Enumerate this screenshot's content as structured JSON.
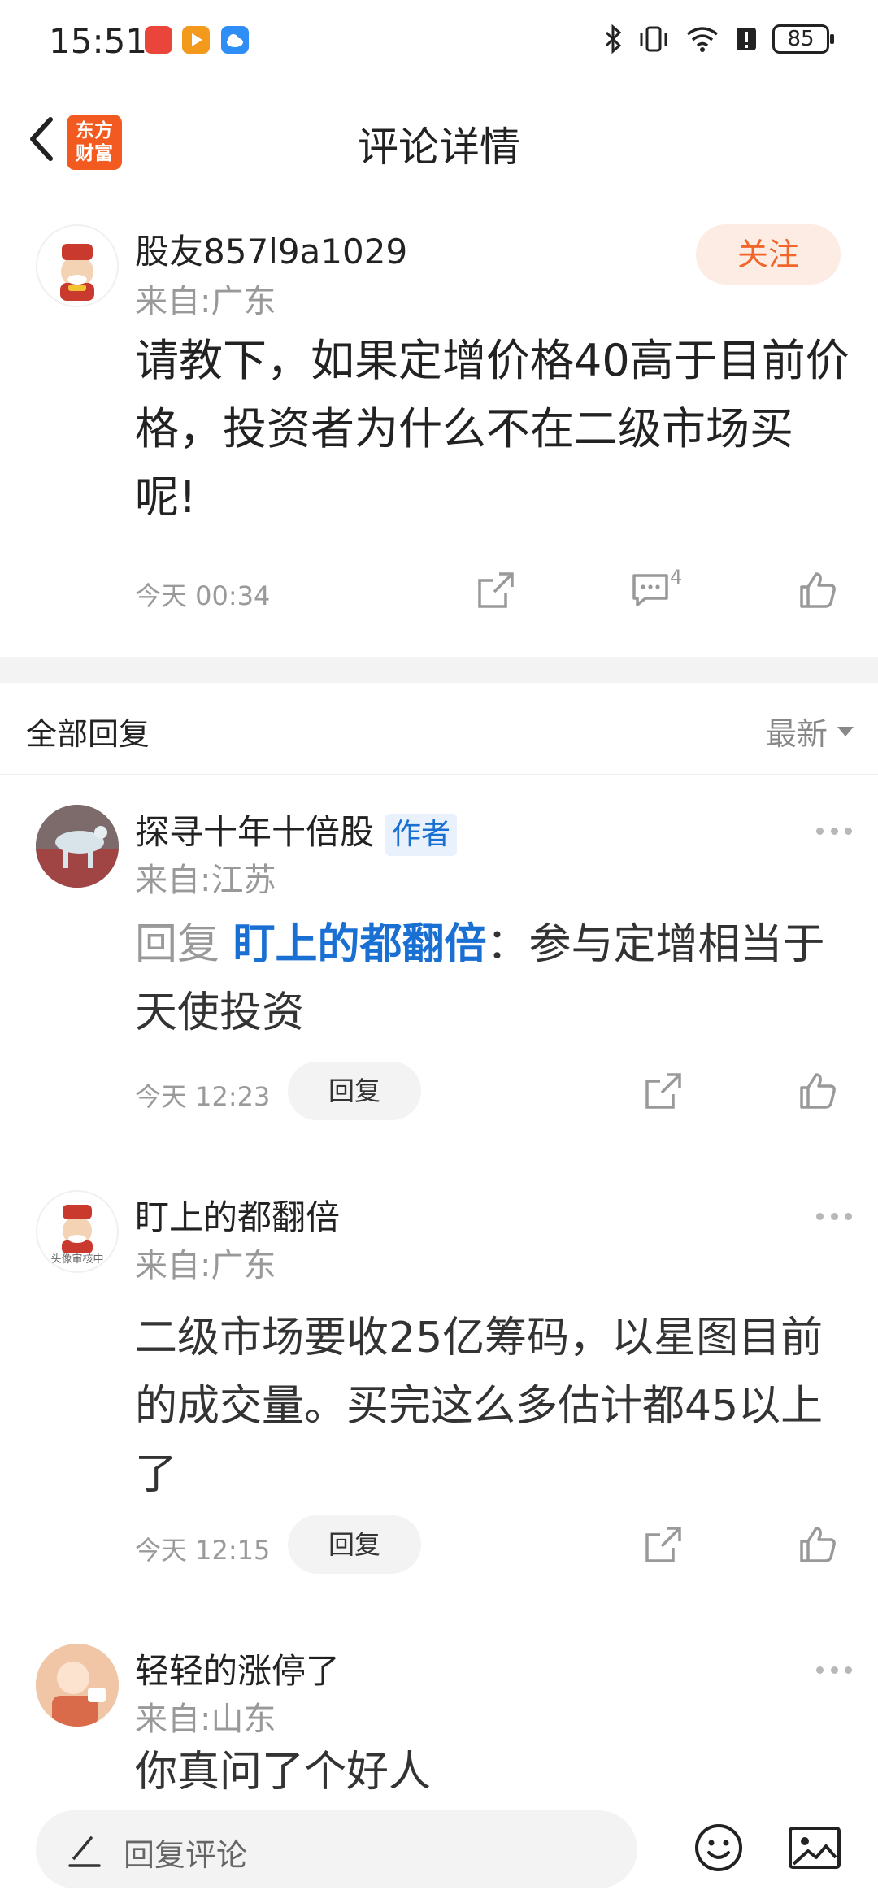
{
  "status_bar": {
    "time": "15:51",
    "battery": "85",
    "icons": [
      "app-notification-icon",
      "video-app-icon",
      "cloud-icon",
      "bluetooth-icon",
      "vibrate-icon",
      "wifi-icon",
      "alert-icon"
    ]
  },
  "header": {
    "title": "评论详情",
    "logo_line1": "东方",
    "logo_line2": "财富",
    "accent": "#f25a1f"
  },
  "main_post": {
    "username": "股友857l9a1029",
    "location": "来自:广东",
    "follow_label": "关注",
    "text": "请教下，如果定增价格40高于目前价格，投资者为什么不在二级市场买呢!",
    "time": "今天 00:34",
    "comment_count": "4"
  },
  "replies_header": {
    "label": "全部回复",
    "sort": "最新"
  },
  "replies": [
    {
      "username": "探寻十年十倍股",
      "tag": "作者",
      "location": "来自:江苏",
      "prefix": "回复 ",
      "target": "盯上的都翻倍",
      "text": "：参与定增相当于天使投资",
      "time": "今天 12:23",
      "reply_label": "回复"
    },
    {
      "username": "盯上的都翻倍",
      "location": "来自:广东",
      "avatar_caption": "头像审核中",
      "text": "二级市场要收25亿筹码，以星图目前的成交量。买完这么多估计都45以上了",
      "time": "今天 12:15",
      "reply_label": "回复"
    },
    {
      "username": "轻轻的涨停了",
      "location": "来自:山东",
      "text": "你真问了个好人"
    }
  ],
  "bottom_bar": {
    "placeholder": "回复评论"
  },
  "colors": {
    "link": "#1a6fd2",
    "follow_bg": "#fdece3",
    "follow_text": "#f2652a"
  }
}
